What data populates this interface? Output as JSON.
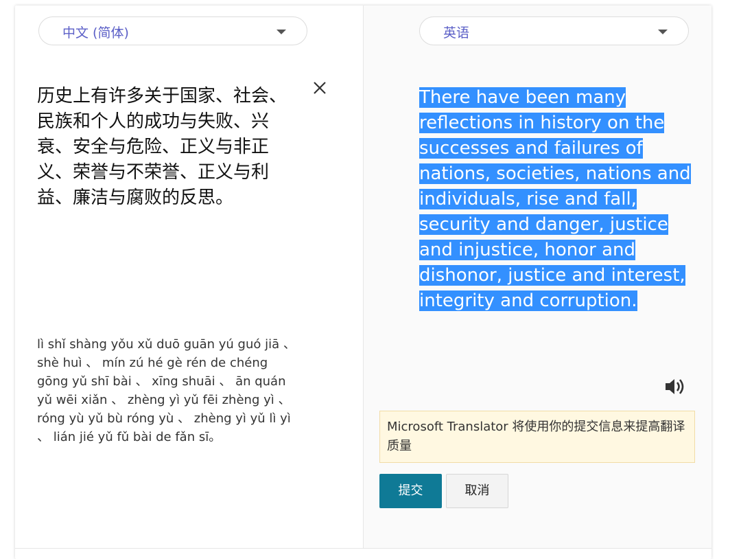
{
  "source": {
    "language": "中文 (简体)",
    "text": "历史上有许多关于国家、社会、民族和个人的成功与失败、兴衰、安全与危险、正义与非正义、荣誉与不荣誉、正义与利益、廉洁与腐败的反思。",
    "pinyin": "lì shǐ shàng yǒu xǔ duō guān yú guó jiā 、 shè huì 、 mín zú hé gè rén de chéng gōng yǔ shī bài 、 xīng shuāi 、 ān quán yǔ wēi xiǎn 、 zhèng yì yǔ fēi zhèng yì 、 róng yù yǔ bù róng yù 、 zhèng yì yǔ lì yì 、 lián jié yǔ fǔ bài de fǎn sī。"
  },
  "target": {
    "language": "英语",
    "text": "There have been many reflections in history on the successes and failures of nations, societies, nations and individuals, rise and fall, security and danger, justice and injustice, honor and dishonor, justice and interest, integrity and corruption."
  },
  "feedback": {
    "notice": "Microsoft Translator 将使用你的提交信息来提高翻译质量",
    "submit_label": "提交",
    "cancel_label": "取消"
  },
  "colors": {
    "accent": "#5b5fc7",
    "selection": "#3390ff",
    "submit": "#0f7a96",
    "notice_bg": "#fff8e1"
  },
  "icons": {
    "clear": "close-icon",
    "speaker": "speaker-icon",
    "dropdown": "chevron-down-icon"
  }
}
